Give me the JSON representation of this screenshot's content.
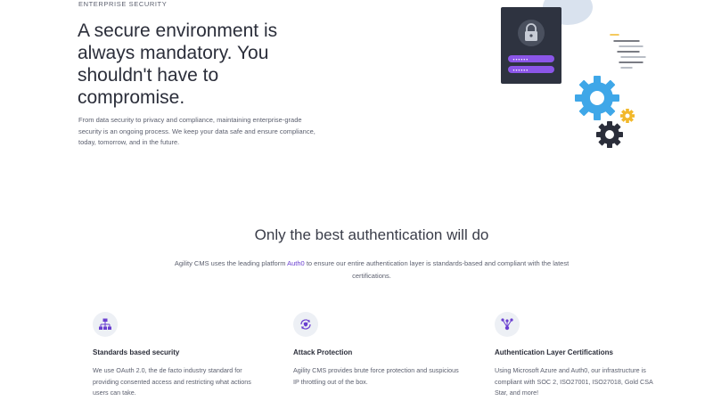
{
  "hero": {
    "eyebrow": "ENTERPRISE SECURITY",
    "title": "A secure environment is always mandatory. You shouldn't have to compromise.",
    "description": "From data security to privacy and compliance, maintaining enterprise-grade security is an ongoing process. We keep your data safe and ensure compliance, today, tomorrow, and in the future.",
    "illustration_icons": [
      "lock-icon",
      "password-field",
      "gear-icon",
      "list-lines-icon"
    ],
    "password_mask": "••••••"
  },
  "auth_section": {
    "title": "Only the best authentication will do",
    "description_before": "Agility CMS uses the leading platform ",
    "link_text": "Auth0",
    "description_after": " to ensure our entire authentication layer is standards-based and compliant with the latest certifications."
  },
  "features": [
    {
      "icon": "sitemap-icon",
      "title": "Standards based security",
      "description": "We use OAuth 2.0, the de facto industry standard for providing consented access and restricting what actions users can take."
    },
    {
      "icon": "shield-refresh-icon",
      "title": "Attack Protection",
      "description": "Agility CMS provides brute force protection and suspicious IP throttling out of the box."
    },
    {
      "icon": "network-icon",
      "title": "Authentication Layer Certifications",
      "description": "Using Microsoft Azure and Auth0, our infrastructure is compliant with SOC 2, ISO27001, ISO27018, Gold CSA Star, and more!"
    }
  ],
  "colors": {
    "accent_purple": "#6a3fd0",
    "gear_blue": "#3fa7e8",
    "gear_yellow": "#f2b82a",
    "gear_dark": "#2b2e3a",
    "card_dark": "#2e3340"
  }
}
